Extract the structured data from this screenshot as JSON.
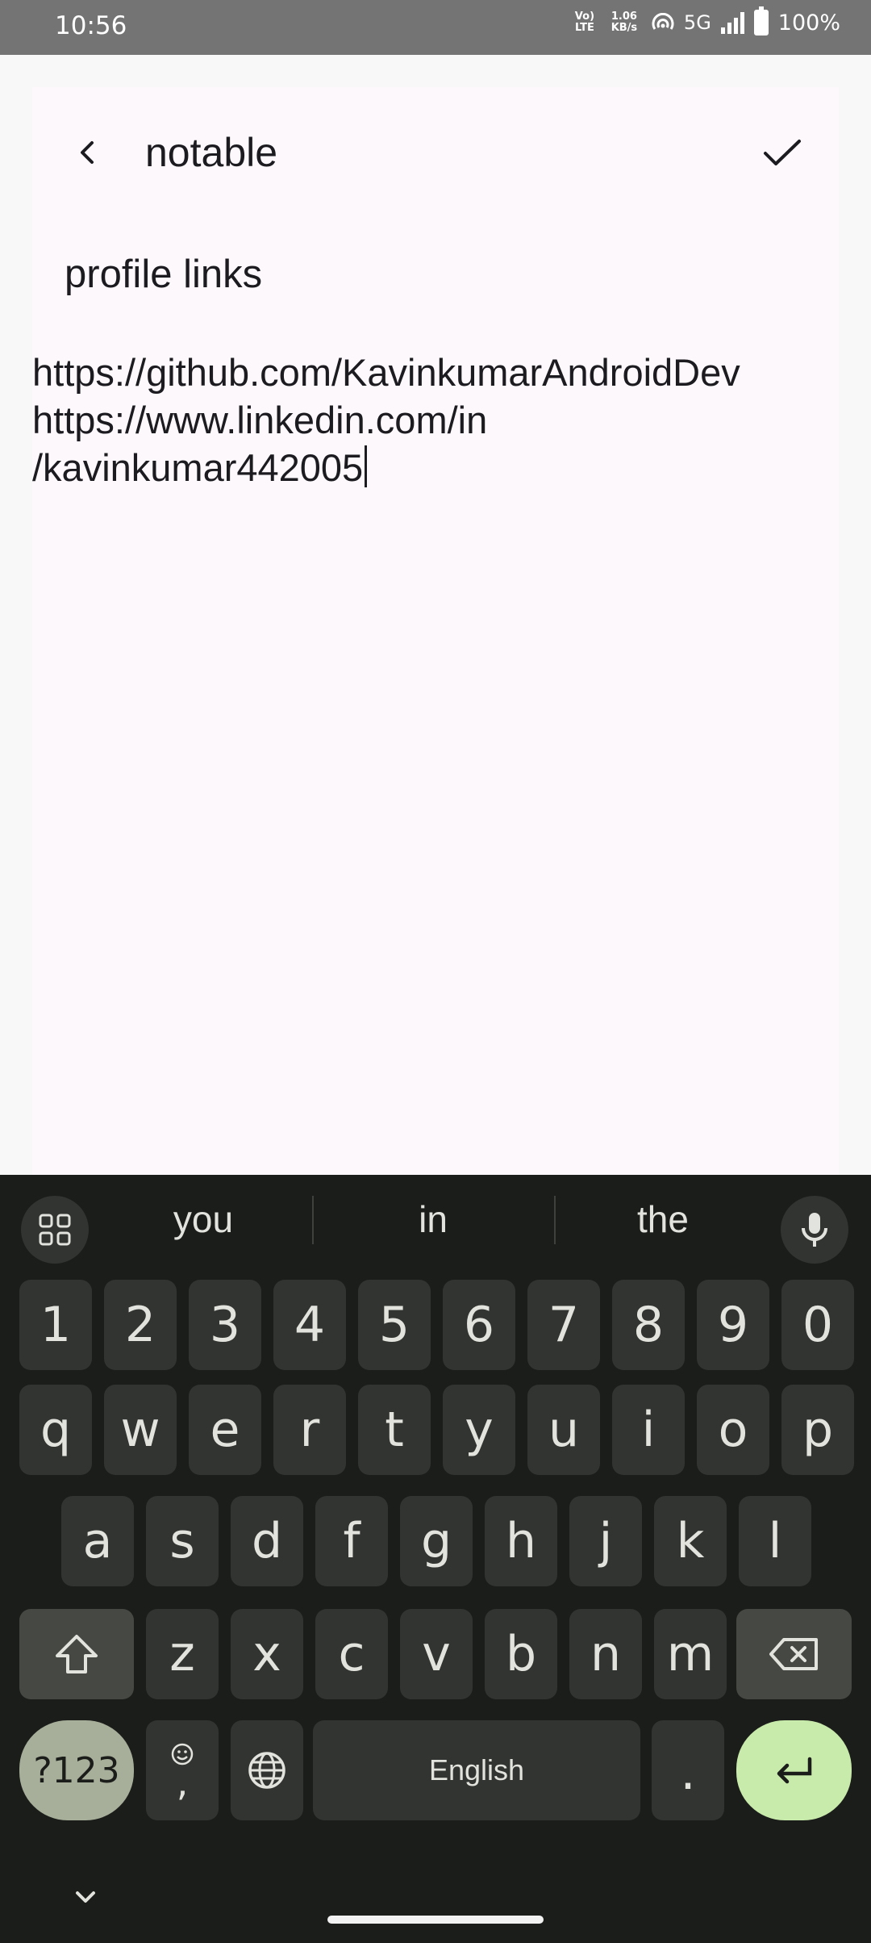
{
  "status_bar": {
    "time": "10:56",
    "volte": "Vo) LTE",
    "speed": "1.06 KB/s",
    "network": "5G",
    "battery": "100%"
  },
  "toolbar": {
    "back_icon": "chevron-left-icon",
    "app_title": "notable",
    "save_icon": "check-icon"
  },
  "note": {
    "title": "profile links",
    "body": "https://github.com/KavinkumarAndroidDev\nhttps://www.linkedin.com/in\n/kavinkumar442005"
  },
  "keyboard": {
    "suggestions": [
      "you",
      "in",
      "the"
    ],
    "number_row": [
      "1",
      "2",
      "3",
      "4",
      "5",
      "6",
      "7",
      "8",
      "9",
      "0"
    ],
    "row1": [
      "q",
      "w",
      "e",
      "r",
      "t",
      "y",
      "u",
      "i",
      "o",
      "p"
    ],
    "row2": [
      "a",
      "s",
      "d",
      "f",
      "g",
      "h",
      "j",
      "k",
      "l"
    ],
    "row3": [
      "z",
      "x",
      "c",
      "v",
      "b",
      "n",
      "m"
    ],
    "symbols_label": "?123",
    "emoji_comma": ",",
    "space_label": "English",
    "period_label": ".",
    "accent_color": "#c8eaaa"
  }
}
